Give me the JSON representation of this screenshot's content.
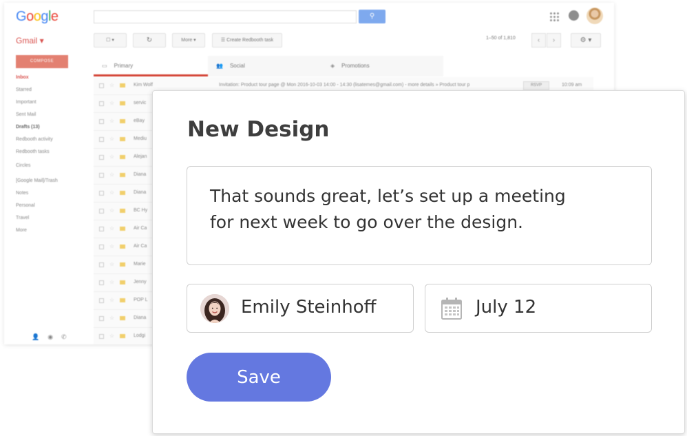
{
  "gmail": {
    "logo": "Google",
    "search_button_icon": "search-icon",
    "app_label": "Gmail",
    "toolbar": {
      "more_label": "More",
      "create_task_label": "Create Redbooth task"
    },
    "paging": "1–50 of 1,810",
    "compose_label": "COMPOSE",
    "folders": [
      "Inbox",
      "Starred",
      "Important",
      "Sent Mail",
      "Drafts (13)",
      "Redbooth activity",
      "Redbooth tasks",
      "Circles",
      "[Google Mail]/Trash",
      "Notes",
      "Personal",
      "Travel",
      "More"
    ],
    "tabs": [
      "Primary",
      "Social",
      "Promotions"
    ],
    "rows": [
      {
        "sender": "Kim Wolf",
        "subject": "Invitation: Product tour page @ Mon 2016-10-03 14:00 - 14:30 (lisatemes@gmail.com) - more details » Product tour p",
        "rsvp": "RSVP",
        "time": "10:09 am"
      },
      {
        "sender": "servic",
        "subject": "",
        "rsvp": "",
        "time": ""
      },
      {
        "sender": "eBay",
        "subject": "",
        "rsvp": "",
        "time": ""
      },
      {
        "sender": "Mediu",
        "subject": "",
        "rsvp": "",
        "time": ""
      },
      {
        "sender": "Alejan",
        "subject": "",
        "rsvp": "",
        "time": ""
      },
      {
        "sender": "Diana",
        "subject": "",
        "rsvp": "",
        "time": ""
      },
      {
        "sender": "Diana",
        "subject": "",
        "rsvp": "",
        "time": ""
      },
      {
        "sender": "BC Hy",
        "subject": "",
        "rsvp": "",
        "time": ""
      },
      {
        "sender": "Air Ca",
        "subject": "",
        "rsvp": "",
        "time": ""
      },
      {
        "sender": "Air Ca",
        "subject": "",
        "rsvp": "",
        "time": ""
      },
      {
        "sender": "Marie",
        "subject": "",
        "rsvp": "",
        "time": ""
      },
      {
        "sender": "Jenny",
        "subject": "",
        "rsvp": "",
        "time": ""
      },
      {
        "sender": "POP L",
        "subject": "",
        "rsvp": "",
        "time": ""
      },
      {
        "sender": "Diana",
        "subject": "",
        "rsvp": "",
        "time": ""
      },
      {
        "sender": "Lodgi",
        "subject": "",
        "rsvp": "",
        "time": ""
      }
    ]
  },
  "card": {
    "title": "New Design",
    "message": "That sounds great, let’s set up a meeting for next week to go over the design.",
    "assignee": {
      "name": "Emily Steinhoff",
      "avatar_icon": "user-avatar"
    },
    "due_date": {
      "value": "July 12",
      "icon": "calendar-icon"
    },
    "save_label": "Save",
    "colors": {
      "save_button": "#6478e0",
      "title": "#3e3e3e"
    }
  }
}
